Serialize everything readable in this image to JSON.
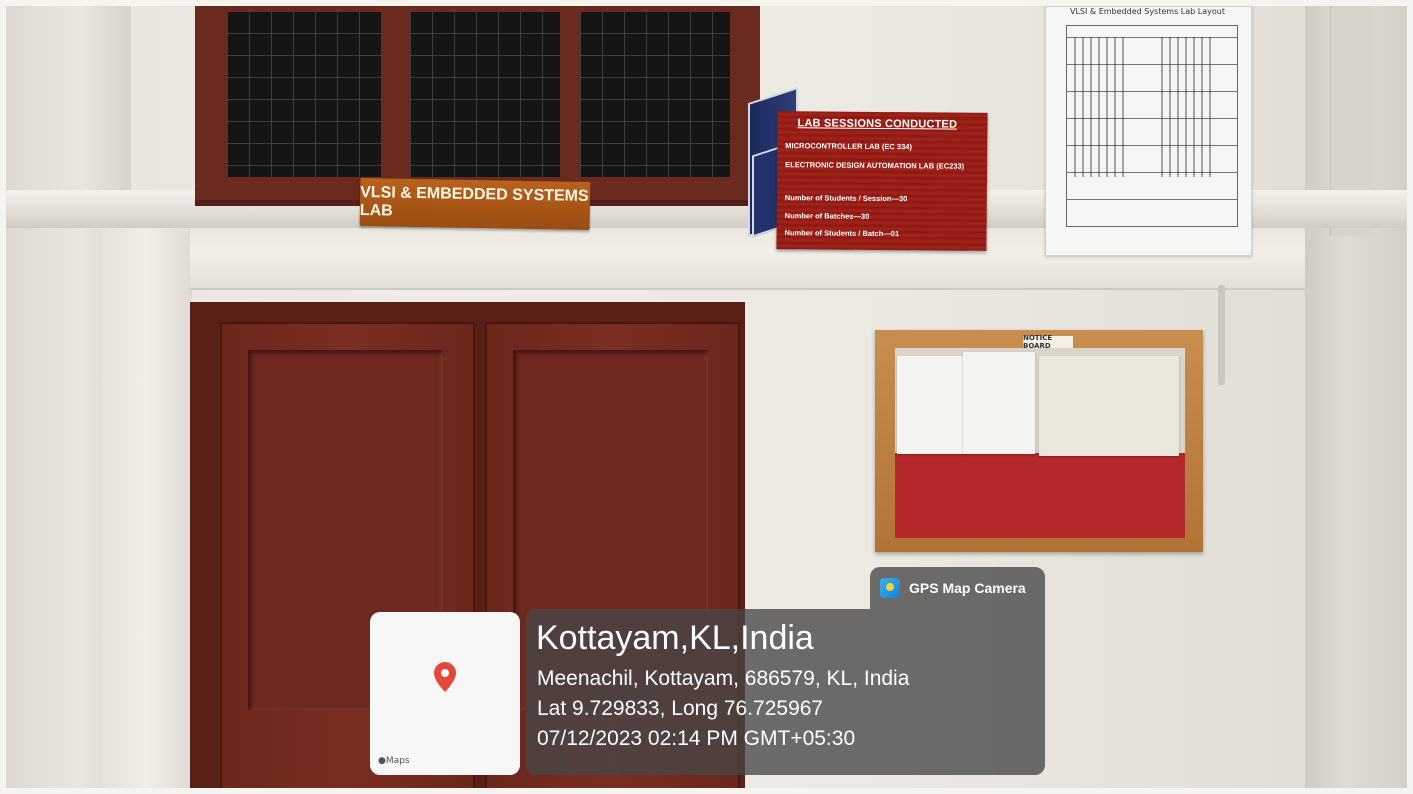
{
  "signs": {
    "lab_name": "VLSI & EMBEDDED SYSTEMS LAB",
    "sessions_board": {
      "title": "LAB SESSIONS CONDUCTED",
      "lines": [
        "MICROCONTROLLER LAB (EC 334)",
        "ELECTRONIC DESIGN AUTOMATION LAB (EC233)",
        "Number of Students / Session—30",
        "Number of Batches—30",
        "Number of Students / Batch—01"
      ]
    },
    "layout_sheet_title": "VLSI & Embedded Systems Lab Layout",
    "notice_board_label": "NOTICE BOARD"
  },
  "gps": {
    "app_name": "GPS Map Camera",
    "location_title": "Kottayam,KL,India",
    "address": "Meenachil, Kottayam, 686579, KL, India",
    "coordinates": "Lat 9.729833, Long 76.725967",
    "datetime": "07/12/2023 02:14 PM GMT+05:30",
    "map_brand": "Maps",
    "pin_color": "#e5483a",
    "overlay_color": "#464646"
  },
  "icons": {
    "app": "gps-map-camera-icon",
    "pin": "map-pin-icon",
    "brand": "apple-logo-icon"
  }
}
